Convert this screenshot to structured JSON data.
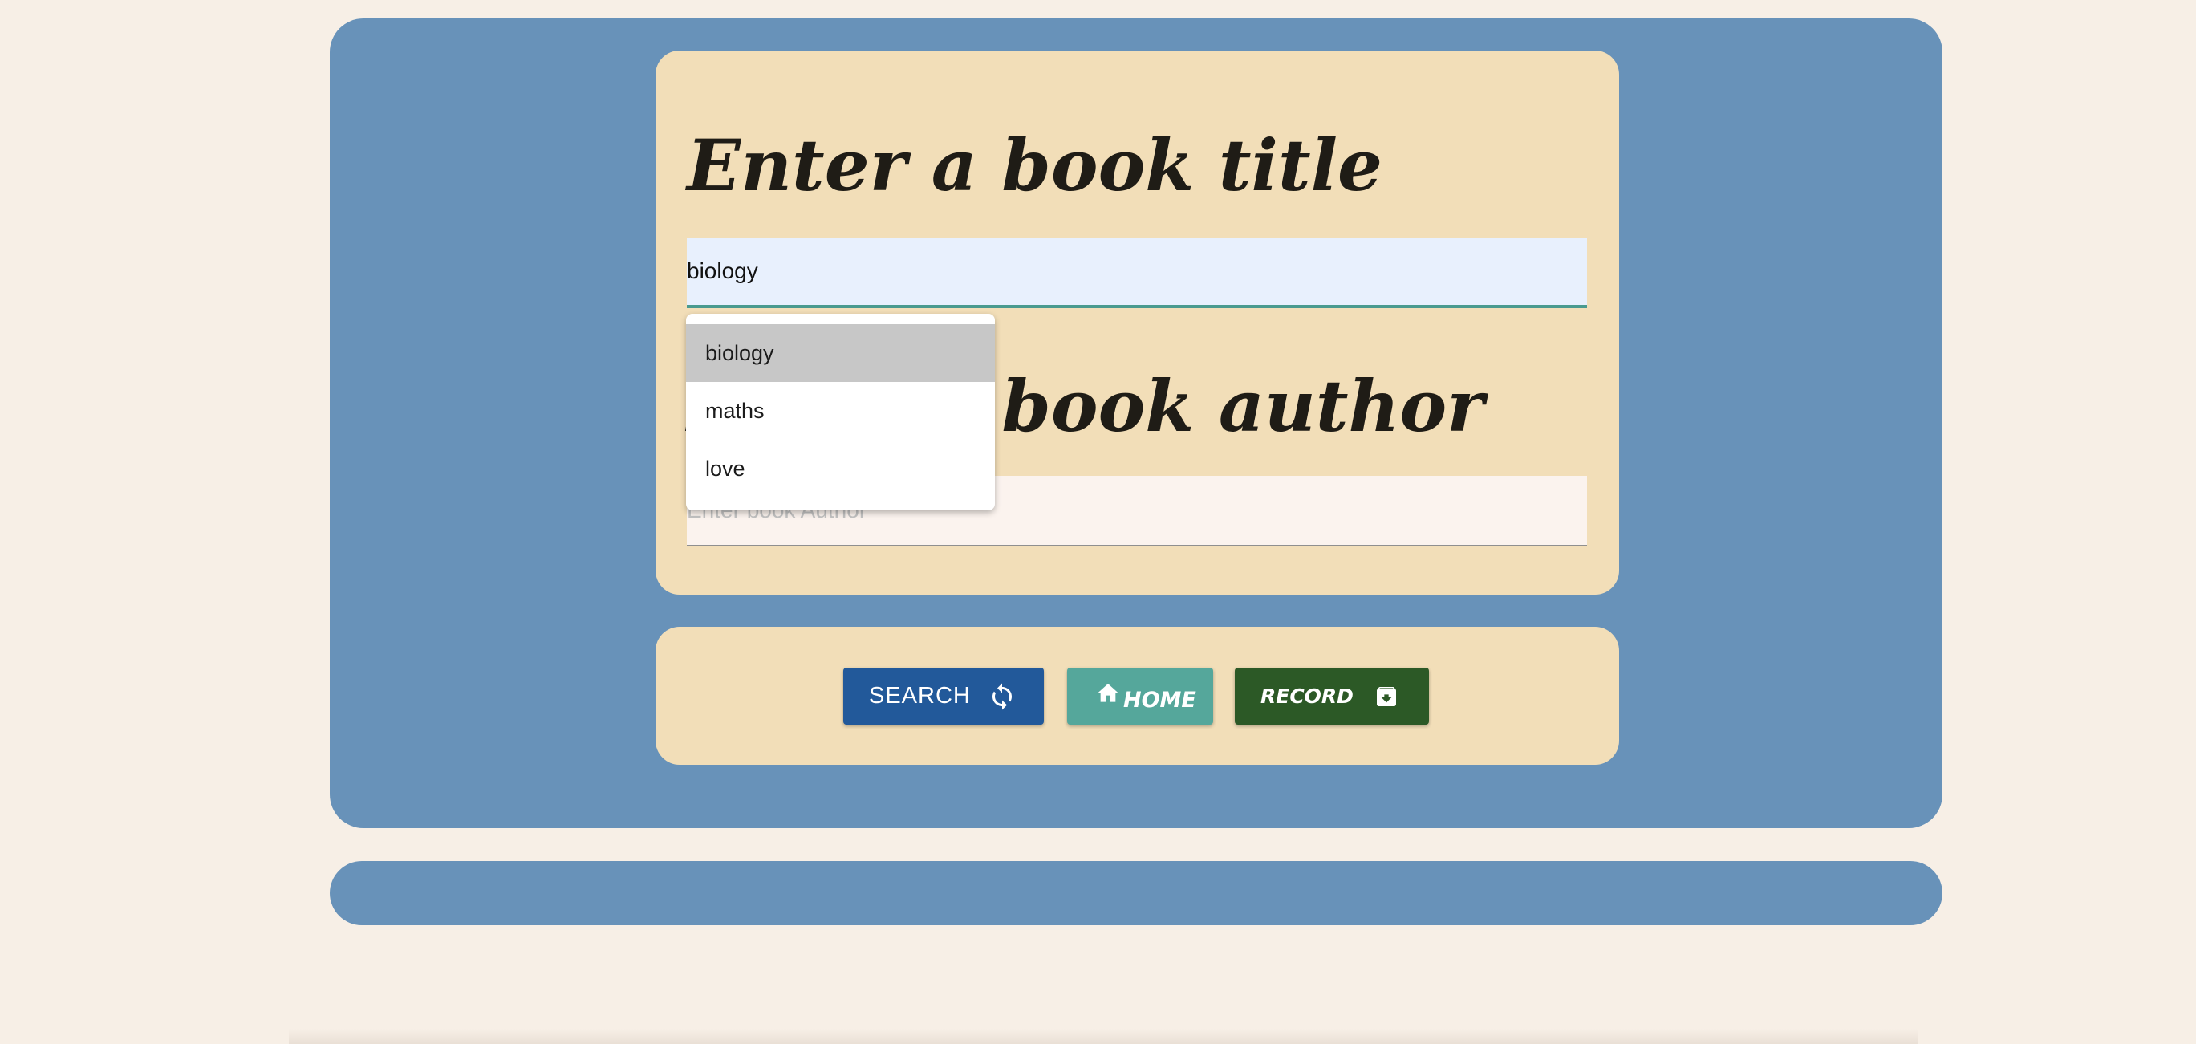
{
  "form": {
    "title_heading": "Enter a book title",
    "title_input": {
      "value": "biology"
    },
    "author_heading": "Enter a book author",
    "author_input": {
      "value": "",
      "placeholder": "Enter book Author"
    },
    "autocomplete": {
      "options": [
        "biology",
        "maths",
        "love"
      ],
      "highlighted": "biology"
    }
  },
  "actions": {
    "search": {
      "label": "SEARCH",
      "icon": "refresh-icon"
    },
    "home": {
      "label": "HOME",
      "icon": "home-icon"
    },
    "record": {
      "label": "RECORD",
      "icon": "archive-icon"
    }
  },
  "colors": {
    "page_background": "#f7efe6",
    "panel_blue": "#6892b9",
    "card_tan": "#f2deb8",
    "search_button": "#22599a",
    "home_button": "#55a79b",
    "record_button": "#2c5926"
  }
}
